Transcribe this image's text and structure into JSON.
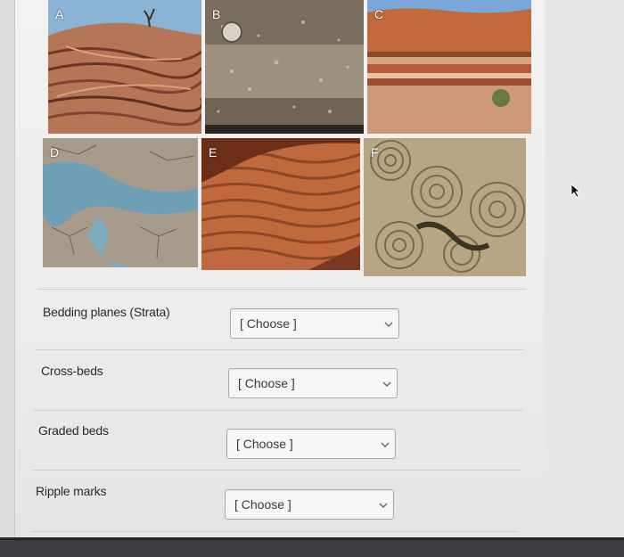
{
  "tiles": [
    {
      "label": "A"
    },
    {
      "label": "B"
    },
    {
      "label": "C"
    },
    {
      "label": "D"
    },
    {
      "label": "E"
    },
    {
      "label": "F"
    }
  ],
  "questions": [
    {
      "term": "Bedding planes (Strata)",
      "selected": "[ Choose ]"
    },
    {
      "term": "Cross-beds",
      "selected": "[ Choose ]"
    },
    {
      "term": "Graded beds",
      "selected": "[ Choose ]"
    },
    {
      "term": "Ripple marks",
      "selected": "[ Choose ]"
    }
  ],
  "icons": {
    "dropdown": "chevron-down-icon",
    "cursor": "mouse-pointer-icon"
  }
}
